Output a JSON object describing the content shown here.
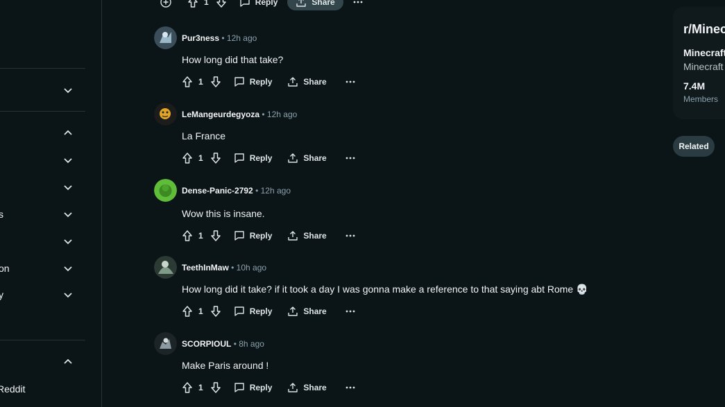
{
  "sidebar": {
    "rows": [
      {
        "label": "",
        "chevron": "down"
      },
      {
        "label": "",
        "chevron": "up"
      },
      {
        "label": "",
        "chevron": "down"
      },
      {
        "label": "",
        "chevron": "down"
      },
      {
        "label": "s",
        "chevron": "down"
      },
      {
        "label": "",
        "chevron": "down"
      },
      {
        "label": "on",
        "chevron": "down"
      },
      {
        "label": "y",
        "chevron": "down"
      },
      {
        "label": "",
        "chevron": "up"
      }
    ],
    "bottom_label": "Reddit"
  },
  "top_actions": {
    "votes": "1",
    "reply_label": "Reply",
    "share_label": "Share"
  },
  "comments": [
    {
      "user": "Pur3ness",
      "time": "12h ago",
      "text": "How long did that take?",
      "votes": "1",
      "reply_label": "Reply",
      "share_label": "Share"
    },
    {
      "user": "LeMangeurdegyoza",
      "time": "12h ago",
      "text": "La France",
      "votes": "1",
      "reply_label": "Reply",
      "share_label": "Share"
    },
    {
      "user": "Dense-Panic-2792",
      "time": "12h ago",
      "text": "Wow this is insane.",
      "votes": "1",
      "reply_label": "Reply",
      "share_label": "Share"
    },
    {
      "user": "TeethInMaw",
      "time": "10h ago",
      "text": "How long did it take? if it took a day I was gonna make a reference to that saying abt Rome 💀",
      "votes": "1",
      "reply_label": "Reply",
      "share_label": "Share"
    },
    {
      "user": "SCORPIOUL",
      "time": "8h ago",
      "text": "Make Paris around !",
      "votes": "1",
      "reply_label": "Reply",
      "share_label": "Share"
    }
  ],
  "community_card": {
    "name": "r/Minec",
    "title": "Minecraft",
    "subtitle": "Minecraft",
    "members_count": "7.4M",
    "members_label": "Members"
  },
  "related_button": "Related",
  "colors": {
    "background": "#0b1416",
    "card": "#101a1d",
    "muted_text": "#8ba2ad",
    "share_pill": "#33464c"
  }
}
